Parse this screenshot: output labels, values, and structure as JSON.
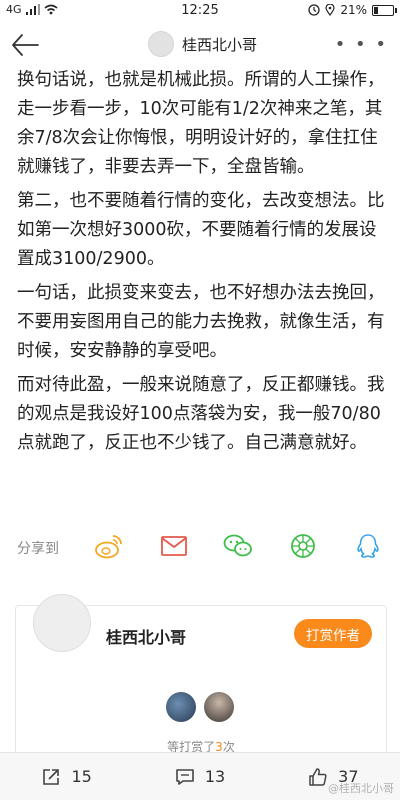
{
  "status_bar": {
    "network": "4G",
    "time": "12:25",
    "battery_text": "21%",
    "battery_level": 0.21
  },
  "nav": {
    "title": "桂西北小哥",
    "back_icon": "arrow-left-icon",
    "more_icon": "more-dots-icon"
  },
  "article": {
    "paragraphs": [
      "换句话说，也就是机械此损。所谓的人工操作，走一步看一步，10次可能有1/2次神来之笔，其余7/8次会让你悔恨，明明设计好的，拿住扛住就赚钱了，非要去弄一下，全盘皆输。",
      "第二，也不要随着行情的变化，去改变想法。比如第一次想好3000砍，不要随着行情的发展设置成3100/2900。",
      "一句话，此损变来变去，也不好想办法去挽回，不要用妄图用自己的能力去挽救，就像生活，有时候，安安静静的享受吧。",
      "而对待此盈，一般来说随意了，反正都赚钱。我的观点是我设好100点落袋为安，我一般70/80点就跑了，反正也不少钱了。自己满意就好。"
    ]
  },
  "share": {
    "label": "分享到",
    "targets": [
      "weibo-icon",
      "mail-icon",
      "wechat-icon",
      "moments-icon",
      "qq-icon"
    ]
  },
  "author_card": {
    "name": "桂西北小哥",
    "tip_button": "打赏作者",
    "tip_prefix": "等打赏了",
    "tip_count": "3",
    "tip_suffix": "次"
  },
  "bottom_bar": {
    "repost_count": "15",
    "comment_count": "13",
    "like_count": "37"
  },
  "watermark": "@桂西北小哥",
  "colors": {
    "accent": "#f98a1b",
    "weibo_orange": "#f5a623",
    "mail_red": "#e25b4b",
    "wechat_green": "#3dbd4a",
    "qq_blue": "#3aa4e8"
  }
}
